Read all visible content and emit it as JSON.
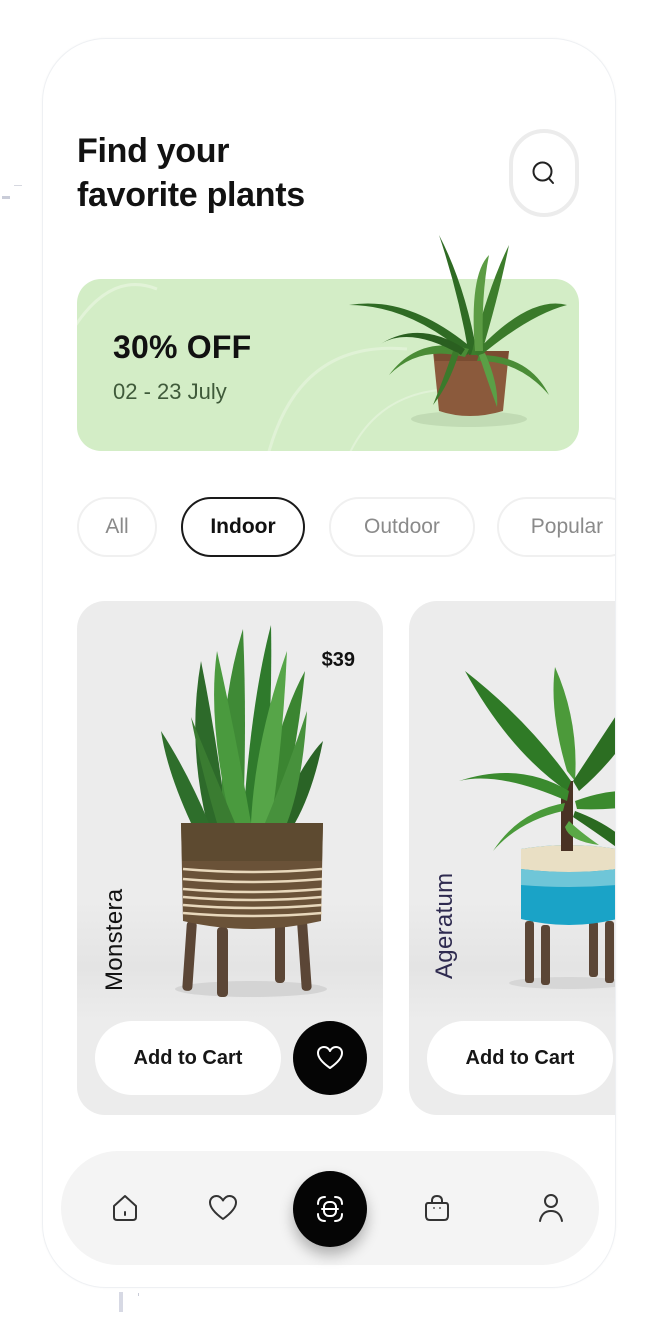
{
  "header": {
    "title_line1": "Find your",
    "title_line2": "favorite plants",
    "search_icon": "search-icon"
  },
  "promo": {
    "title": "30% OFF",
    "dates": "02 - 23 July",
    "background_color": "#d3edc6",
    "image": "potted-plant-terracotta"
  },
  "categories": [
    {
      "label": "All",
      "active": false
    },
    {
      "label": "Indoor",
      "active": true
    },
    {
      "label": "Outdoor",
      "active": false
    },
    {
      "label": "Popular",
      "active": false
    }
  ],
  "products": [
    {
      "name": "Monstera",
      "price": "$39",
      "cart_label": "Add to Cart",
      "favorite_icon": "heart-icon",
      "image": "spiky-plant-striped-pot"
    },
    {
      "name": "Ageratum",
      "cart_label": "Add to Cart",
      "image": "banana-plant-blue-pot"
    }
  ],
  "bottom_nav": [
    {
      "icon": "home-icon",
      "label": "Home"
    },
    {
      "icon": "heart-icon",
      "label": "Favorites"
    },
    {
      "icon": "scan-icon",
      "label": "Scan",
      "primary": true
    },
    {
      "icon": "shopping-bag-icon",
      "label": "Cart"
    },
    {
      "icon": "user-icon",
      "label": "Profile"
    }
  ],
  "colors": {
    "accent_dark": "#050505",
    "promo_green": "#d3edc6",
    "card_bg": "#ececec",
    "nav_bg": "#f4f4f4"
  }
}
